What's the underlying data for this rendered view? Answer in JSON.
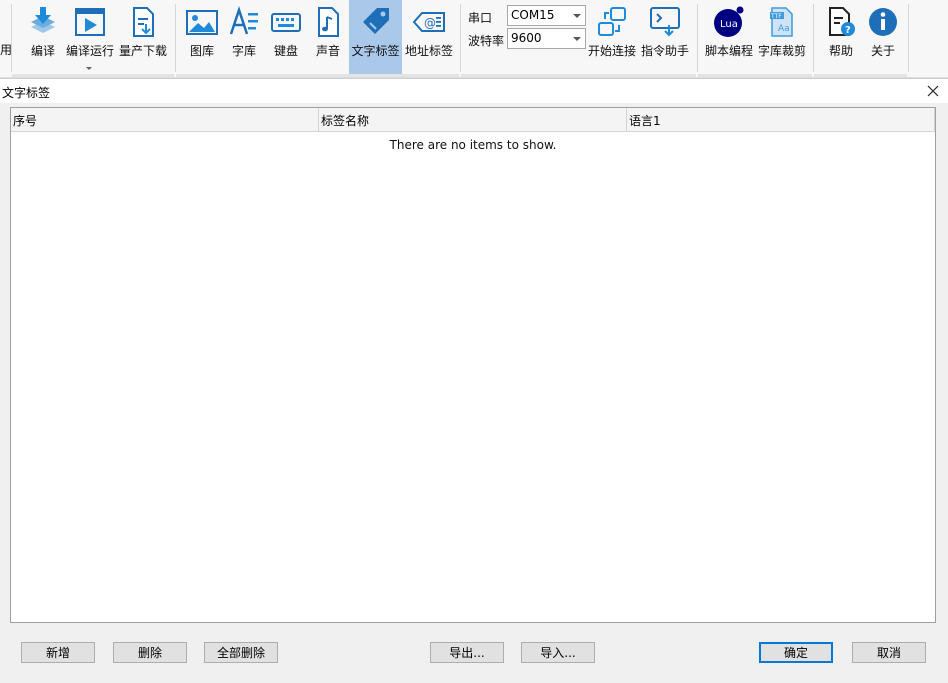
{
  "ribbon": {
    "left_clip_label": "用",
    "items": [
      {
        "key": "compile",
        "label": "编译"
      },
      {
        "key": "compile_run",
        "label": "编译运行"
      },
      {
        "key": "mass_download",
        "label": "量产下载"
      },
      {
        "key": "gallery",
        "label": "图库"
      },
      {
        "key": "font_lib",
        "label": "字库"
      },
      {
        "key": "keyboard",
        "label": "键盘"
      },
      {
        "key": "sound",
        "label": "声音"
      },
      {
        "key": "text_label",
        "label": "文字标签"
      },
      {
        "key": "address_label",
        "label": "地址标签"
      },
      {
        "key": "start_connect",
        "label": "开始连接"
      },
      {
        "key": "cmd_assistant",
        "label": "指令助手"
      },
      {
        "key": "script",
        "label": "脚本编程"
      },
      {
        "key": "font_cut",
        "label": "字库裁剪"
      },
      {
        "key": "help",
        "label": "帮助"
      },
      {
        "key": "about",
        "label": "关于"
      }
    ],
    "serial_port_label": "串口",
    "serial_port_value": "COM15",
    "baud_rate_label": "波特率",
    "baud_rate_value": "9600"
  },
  "dialog": {
    "title": "文字标签",
    "columns": [
      "序号",
      "标签名称",
      "语言1"
    ],
    "empty_message": "There are no items to show.",
    "buttons": {
      "add": "新增",
      "delete": "删除",
      "delete_all": "全部删除",
      "export": "导出...",
      "import": "导入...",
      "ok": "确定",
      "cancel": "取消"
    }
  },
  "colors": {
    "active_tool_bg": "#aac8ea",
    "icon_blue": "#1f8ad8",
    "default_button_border": "#0078d7"
  }
}
